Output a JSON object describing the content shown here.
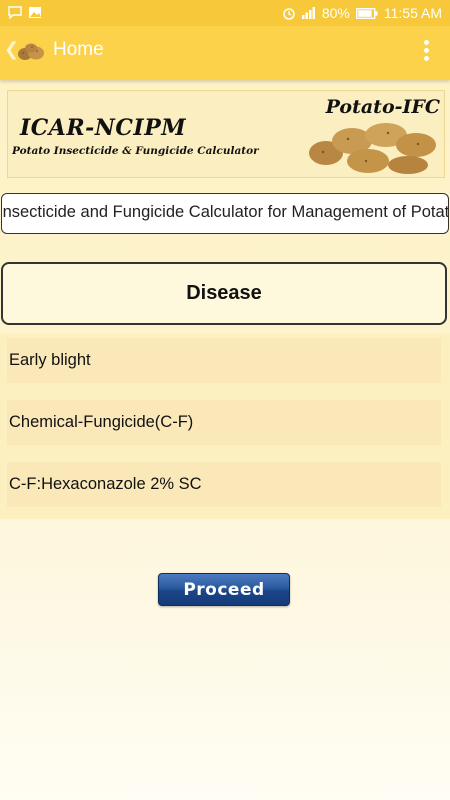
{
  "status_bar": {
    "battery_percent": "80%",
    "time": "11:55 AM",
    "icons": [
      "chat-icon",
      "image-icon",
      "alarm-icon",
      "signal-icon",
      "battery-icon"
    ]
  },
  "app_bar": {
    "title": "Home",
    "icons": [
      "back-icon",
      "potato-logo-icon",
      "overflow-menu-icon"
    ]
  },
  "banner": {
    "brand": "ICAR-NCIPM",
    "app_name": "Potato-IFC",
    "subtitle": "Potato Insecticide & Fungicide Calculator"
  },
  "description": "Insecticide and Fungicide Calculator for Management of Potato",
  "section": {
    "heading": "Disease"
  },
  "selections": [
    {
      "label": "Early blight"
    },
    {
      "label": "Chemical-Fungicide(C-F)"
    },
    {
      "label": "C-F:Hexaconazole 2% SC"
    }
  ],
  "actions": {
    "proceed_label": "Proceed"
  },
  "colors": {
    "status_bar": "#f7c93a",
    "app_bar": "#fcd24a",
    "row_background": "#fbe8b9",
    "proceed_button": "#1c4588"
  }
}
